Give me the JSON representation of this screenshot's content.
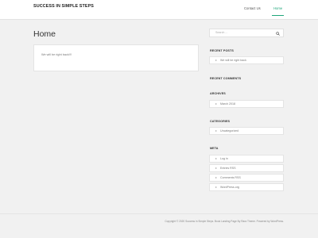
{
  "header": {
    "site_title": "SUCCESS IN SIMPLE STEPS",
    "nav": [
      {
        "label": "Contact Us"
      },
      {
        "label": "Home"
      }
    ]
  },
  "main": {
    "page_title": "Home",
    "content_text": "We will be right back!!!"
  },
  "sidebar": {
    "search_placeholder": "Search ...",
    "recent_posts": {
      "title": "RECENT POSTS",
      "items": [
        "We will be right back"
      ]
    },
    "recent_comments": {
      "title": "RECENT COMMENTS"
    },
    "archives": {
      "title": "ARCHIVES",
      "items": [
        "March 2018"
      ]
    },
    "categories": {
      "title": "CATEGORIES",
      "items": [
        "Uncategorized"
      ]
    },
    "meta": {
      "title": "META",
      "items": [
        "Log in",
        "Entries RSS",
        "Comments RSS",
        "WordPress.org"
      ]
    }
  },
  "footer": {
    "text": "Copyright © 2020 Success in Simple Steps.  Book Landing Page By Rara Theme. Powered by WordPress."
  },
  "colors": {
    "accent": "#1fa67a",
    "background": "#f1f1f1"
  }
}
